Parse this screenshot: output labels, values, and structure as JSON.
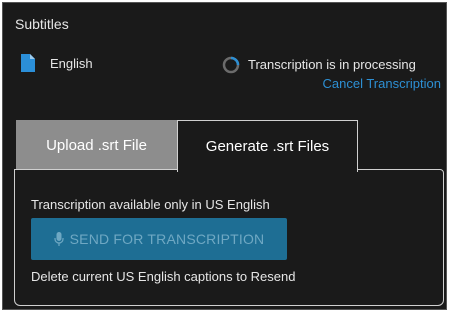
{
  "panel": {
    "title": "Subtitles"
  },
  "track": {
    "language": "English",
    "icon": "file-icon",
    "status_icon": "spinner-icon",
    "status_text": "Transcription is in processing",
    "cancel_label": "Cancel Transcription"
  },
  "tabs": [
    {
      "label": "Upload .srt File",
      "active": false
    },
    {
      "label": "Generate .srt Files",
      "active": true
    }
  ],
  "generate": {
    "availability_note": "Transcription available only in US English",
    "send_button_label": "SEND FOR TRANSCRIPTION",
    "send_button_icon": "microphone-icon",
    "send_button_enabled": false,
    "resend_note": "Delete current US English captions to Resend"
  },
  "colors": {
    "background": "#1a1a1a",
    "link": "#2d8fd3",
    "button": "#1e6e94",
    "inactive_tab": "#8d8d8d"
  }
}
